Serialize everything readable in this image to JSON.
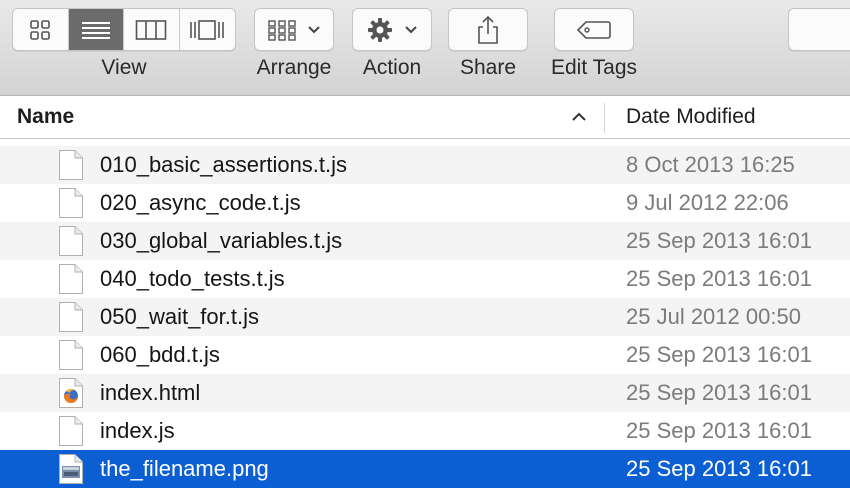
{
  "toolbar": {
    "view_label": "View",
    "arrange_label": "Arrange",
    "action_label": "Action",
    "share_label": "Share",
    "edit_tags_label": "Edit Tags",
    "view_modes": [
      {
        "icon": "icon-view-icon",
        "active": false
      },
      {
        "icon": "list-view-icon",
        "active": true
      },
      {
        "icon": "column-view-icon",
        "active": false
      },
      {
        "icon": "cover-flow-icon",
        "active": false
      }
    ]
  },
  "columns": {
    "name": "Name",
    "date_modified": "Date Modified",
    "sort": "ascending"
  },
  "files": [
    {
      "name": "010_basic_assertions.t.js",
      "date": "8 Oct 2013 16:25",
      "icon": "document-icon"
    },
    {
      "name": "020_async_code.t.js",
      "date": "9 Jul 2012 22:06",
      "icon": "document-icon"
    },
    {
      "name": "030_global_variables.t.js",
      "date": "25 Sep 2013 16:01",
      "icon": "document-icon"
    },
    {
      "name": "040_todo_tests.t.js",
      "date": "25 Sep 2013 16:01",
      "icon": "document-icon"
    },
    {
      "name": "050_wait_for.t.js",
      "date": "25 Jul 2012 00:50",
      "icon": "document-icon"
    },
    {
      "name": "060_bdd.t.js",
      "date": "25 Sep 2013 16:01",
      "icon": "document-icon"
    },
    {
      "name": "index.html",
      "date": "25 Sep 2013 16:01",
      "icon": "firefox-document-icon"
    },
    {
      "name": "index.js",
      "date": "25 Sep 2013 16:01",
      "icon": "document-icon"
    },
    {
      "name": "the_filename.png",
      "date": "25 Sep 2013 16:01",
      "icon": "image-document-icon",
      "selected": true
    }
  ],
  "colors": {
    "selection": "#0b5fd3",
    "alt_row": "#f4f4f4",
    "date_text": "#7b7b7b"
  }
}
